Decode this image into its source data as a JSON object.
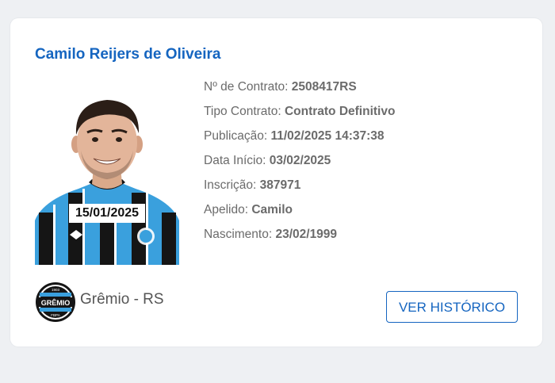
{
  "athlete": {
    "name": "Camilo Reijers de Oliveira",
    "photo_date": "15/01/2025",
    "details": [
      {
        "label": "Nº de Contrato:",
        "value": "2508417RS"
      },
      {
        "label": "Tipo Contrato:",
        "value": "Contrato Definitivo"
      },
      {
        "label": "Publicação:",
        "value": "11/02/2025 14:37:38"
      },
      {
        "label": "Data Início:",
        "value": "03/02/2025"
      },
      {
        "label": "Inscrição:",
        "value": "387971"
      },
      {
        "label": "Apelido:",
        "value": "Camilo"
      },
      {
        "label": "Nascimento:",
        "value": "23/02/1999"
      }
    ]
  },
  "club": {
    "name": "Grêmio - RS",
    "logo_text": "GRÊMIO",
    "logo_years": [
      "1903",
      "FBPA"
    ]
  },
  "actions": {
    "history_label": "VER HISTÓRICO"
  },
  "colors": {
    "accent": "#1565c0",
    "jersey_blue": "#3aa0dd",
    "jersey_black": "#151515"
  }
}
